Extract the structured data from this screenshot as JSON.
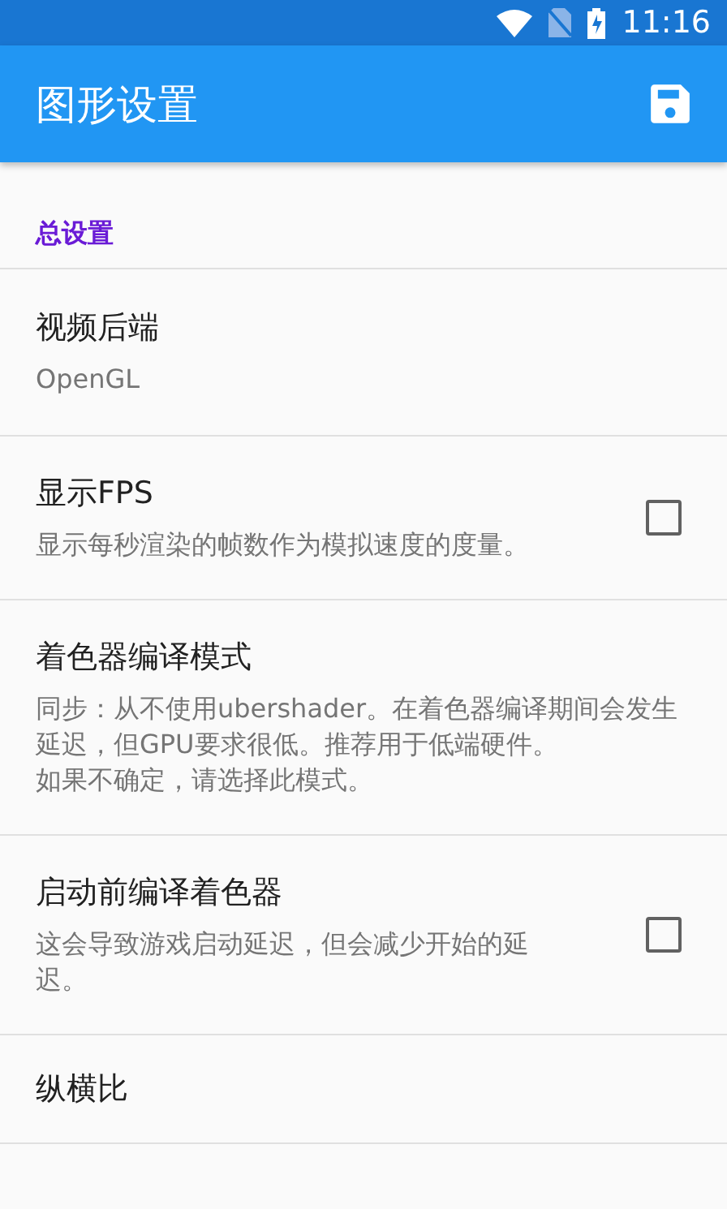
{
  "status_bar": {
    "time": "11:16"
  },
  "app_bar": {
    "title": "图形设置"
  },
  "section": {
    "title": "总设置"
  },
  "settings": [
    {
      "kind": "value",
      "title": "视频后端",
      "summary": "OpenGL"
    },
    {
      "kind": "checkbox",
      "title": "显示FPS",
      "summary": "显示每秒渲染的帧数作为模拟速度的度量。",
      "checked": false
    },
    {
      "kind": "value",
      "title": "着色器编译模式",
      "summary": "同步：从不使用ubershader。在着色器编译期间会发生延迟，但GPU要求很低。推荐用于低端硬件。",
      "note": "如果不确定，请选择此模式。"
    },
    {
      "kind": "checkbox",
      "title": "启动前编译着色器",
      "summary": "这会导致游戏启动延迟，但会减少开始的延迟。",
      "checked": false
    },
    {
      "kind": "value",
      "title": "纵横比"
    }
  ]
}
